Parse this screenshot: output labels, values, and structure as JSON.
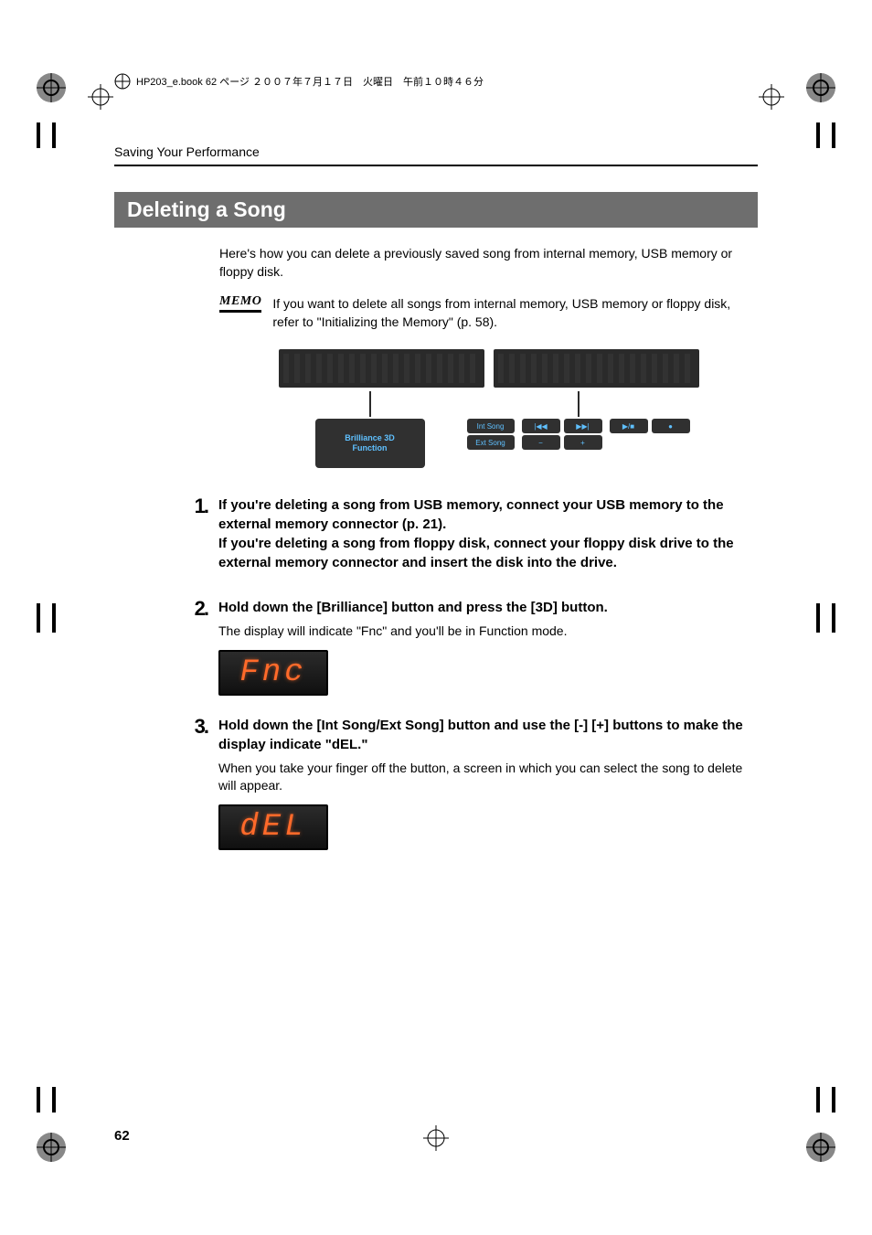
{
  "header_marker": "HP203_e.book 62 ページ ２００７年７月１７日　火曜日　午前１０時４６分",
  "running_head": "Saving Your Performance",
  "heading": "Deleting a Song",
  "intro": "Here's how you can delete a previously saved song from internal memory, USB memory or floppy disk.",
  "memo_label": "MEMO",
  "memo_text": "If you want to delete all songs from internal memory, USB memory or floppy disk, refer to \"Initializing the Memory\" (p. 58).",
  "callout_left_top": "Brilliance 3D",
  "callout_left_bottom": "Function",
  "callout_right": {
    "int_song": "Int Song",
    "ext_song": "Ext Song",
    "prev": "|◀◀",
    "next": "▶▶|",
    "play": "▶/■",
    "rec": "●",
    "minus": "−",
    "plus": "+"
  },
  "steps": [
    {
      "n": "1",
      "head": "If you're deleting a song from USB memory, connect your USB memory to the external memory connector (p. 21).\nIf you're deleting a song from floppy disk, connect your floppy disk drive to the external memory connector and insert the disk into the drive.",
      "text": ""
    },
    {
      "n": "2",
      "head": "Hold down the [Brilliance] button and press the [3D] button.",
      "text": "The display will indicate \"Fnc\" and you'll be in Function mode.",
      "lcd": "Fnc"
    },
    {
      "n": "3",
      "head": "Hold down the [Int Song/Ext Song] button and use the [-] [+] buttons to make the display indicate \"dEL.\"",
      "text": "When you take your finger off the button, a screen in which you can select the song to delete will appear.",
      "lcd": "dEL"
    }
  ],
  "page_number": "62"
}
